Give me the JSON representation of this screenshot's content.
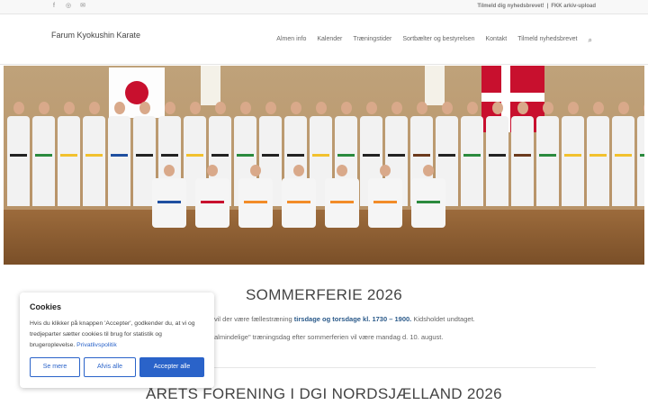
{
  "topbar": {
    "social_icons": [
      "facebook-icon",
      "instagram-icon",
      "mail-icon"
    ],
    "links": [
      "Tilmeld dig nyhedsbrevet!",
      "FKK arkiv-upload"
    ],
    "separator": "|"
  },
  "header": {
    "site_title": "Farum Kyokushin Karate",
    "nav": [
      "Almen info",
      "Kalender",
      "Træningstider",
      "Sortbælter og bestyrelsen",
      "Kontakt",
      "Tilmeld nyhedsbrevet"
    ],
    "search_icon": "search-icon"
  },
  "hero": {
    "belt_colors_adults": [
      "#222222",
      "#2b8a3e",
      "#f2c12e",
      "#f2c12e",
      "#1f4fa0",
      "#222222",
      "#222222",
      "#f2c12e",
      "#222222",
      "#2b8a3e",
      "#222222",
      "#222222",
      "#f2c12e",
      "#2b8a3e",
      "#222222",
      "#222222",
      "#6b3a1e",
      "#222222",
      "#2b8a3e",
      "#222222",
      "#6b3a1e",
      "#2b8a3e",
      "#f2c12e",
      "#f2c12e",
      "#f2c12e",
      "#2b8a3e"
    ],
    "belt_colors_kids": [
      "#1f4fa0",
      "#c8102e",
      "#f28c28",
      "#f28c28",
      "#f28c28",
      "#f28c28",
      "#2b8a3e"
    ]
  },
  "main": {
    "section1_title": "SOMMERFERIE 2026",
    "p1_before": "vil der være fællestræning ",
    "p1_bold": "tirsdage og torsdage kl. 1730 – 1900.",
    "p1_after": " Kidsholdet undtaget.",
    "p2": "almindelige\" træningsdag efter sommerferien vil være mandag d. 10. august.",
    "section2_title": "ÅRETS FORENING I DGI NORDSJÆLLAND 2026"
  },
  "cookie": {
    "title": "Cookies",
    "text": "Hvis du klikker på knappen 'Accepter', godkender du, at vi og tredjeparter sætter cookies til brug for statistik og brugeroplevelse.",
    "policy_link": "Privatlivspolitik",
    "btn_more": "Se mere",
    "btn_refuse": "Afvis alle",
    "btn_accept": "Accepter alle"
  }
}
